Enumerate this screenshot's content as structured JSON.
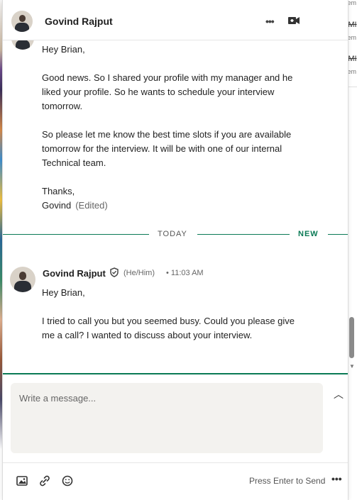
{
  "header": {
    "name": "Govind Rajput",
    "more_icon": "ellipsis-icon",
    "video_icon": "video-call-icon",
    "more_label": "•••"
  },
  "background_files": [
    {
      "name": "EMI",
      "sub": "Rem"
    },
    {
      "name": "EMI",
      "sub": "Rem"
    }
  ],
  "top_sub": "Rem",
  "messages": {
    "first": {
      "text": "Hey Brian,\n\nGood news. So I shared your profile with my manager and he liked your profile. So he wants to schedule your interview tomorrow.\n\nSo please let me know the best time slots if you are available tomorrow for the interview. It will be with one of our internal Technical team.\n\nThanks,",
      "signature": "Govind",
      "edited": "(Edited)"
    },
    "divider": {
      "today": "TODAY",
      "new": "NEW"
    },
    "second": {
      "sender": "Govind Rajput",
      "pronoun": "(He/Him)",
      "time": "• 11:03 AM",
      "text": "Hey Brian,\n\nI tried to call you but you seemed busy. Could you please give me a call? I wanted to discuss about your interview."
    }
  },
  "compose": {
    "placeholder": "Write a message...",
    "expand_label": "︿"
  },
  "footer": {
    "send_hint": "Press Enter to Send",
    "more_label": "•••"
  }
}
